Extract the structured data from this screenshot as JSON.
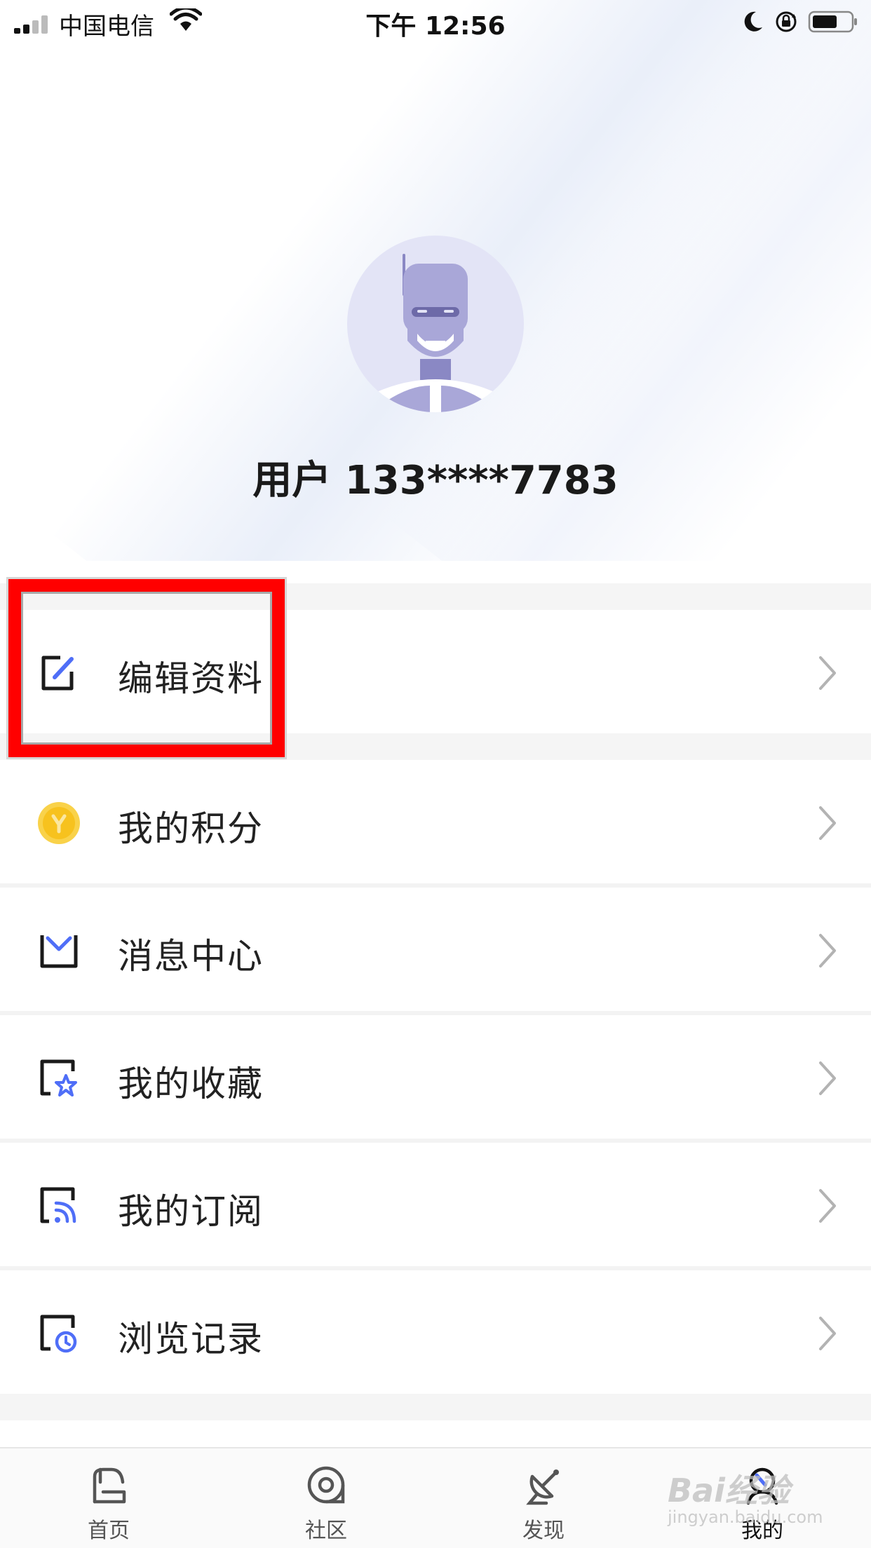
{
  "status_bar": {
    "carrier": "中国电信",
    "time": "下午 12:56"
  },
  "profile": {
    "username": "用户 133****7783"
  },
  "menu": {
    "items": [
      {
        "label": "编辑资料",
        "icon": "edit-icon"
      },
      {
        "label": "我的积分",
        "icon": "coin-icon"
      },
      {
        "label": "消息中心",
        "icon": "mail-icon"
      },
      {
        "label": "我的收藏",
        "icon": "star-bookmark-icon"
      },
      {
        "label": "我的订阅",
        "icon": "rss-subscription-icon"
      },
      {
        "label": "浏览记录",
        "icon": "history-clock-icon"
      }
    ]
  },
  "tab_bar": {
    "tabs": [
      {
        "label": "首页",
        "icon": "home-icon"
      },
      {
        "label": "社区",
        "icon": "community-icon"
      },
      {
        "label": "发现",
        "icon": "discover-satellite-icon"
      },
      {
        "label": "我的",
        "icon": "profile-icon",
        "active": true
      }
    ]
  },
  "colors": {
    "accent_blue": "#4f6ef7",
    "highlight_red": "#ff0000",
    "avatar_bg": "#e3e4f6",
    "avatar_figure": "#8a88c4",
    "coin_yellow": "#f7c21e"
  },
  "watermark": {
    "brand": "Bai经验",
    "url": "jingyan.baidu.com"
  }
}
